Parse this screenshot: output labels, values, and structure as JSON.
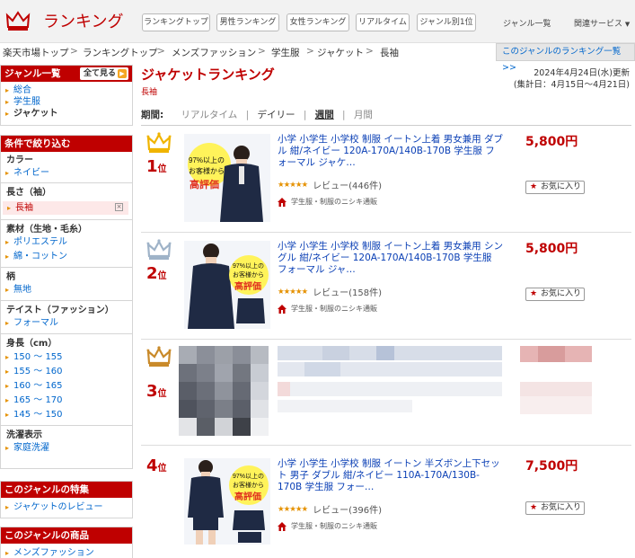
{
  "header": {
    "logo_text": "ランキング",
    "buttons": [
      "ランキングトップ",
      "男性ランキング",
      "女性ランキング",
      "リアルタイム",
      "ジャンル別1位"
    ],
    "links": [
      "ジャンル一覧",
      "関連サービス"
    ]
  },
  "breadcrumb": [
    "楽天市場トップ",
    "ランキングトップ",
    "メンズファッション",
    "学生服",
    "ジャケット",
    "長袖"
  ],
  "genre_ranking_link": "このジャンルのランキング一覧 >>",
  "sidebar": {
    "genre_title": "ジャンル一覧",
    "show_all": "全て見る",
    "genre_items": [
      "総合",
      "学生服",
      "ジャケット"
    ],
    "filter_title": "条件で絞り込む",
    "color_title": "カラー",
    "color_items": [
      "ネイビー"
    ],
    "sleeve_title": "長さ（袖）",
    "sleeve_items": [
      "長袖"
    ],
    "material_title": "素材（生地・毛糸）",
    "material_items": [
      "ポリエステル",
      "綿・コットン"
    ],
    "pattern_title": "柄",
    "pattern_items": [
      "無地"
    ],
    "taste_title": "テイスト（ファッション）",
    "taste_items": [
      "フォーマル"
    ],
    "height_title": "身長（cm）",
    "height_items": [
      "150 ～ 155",
      "155 ～ 160",
      "160 ～ 165",
      "165 ～ 170",
      "145 ～ 150"
    ],
    "wash_title": "洗濯表示",
    "wash_items": [
      "家庭洗濯"
    ],
    "feature_title": "このジャンルの特集",
    "feature_items": [
      "ジャケットのレビュー"
    ],
    "products_title": "このジャンルの商品",
    "products_items": [
      "メンズファッション"
    ]
  },
  "main": {
    "title": "ジャケットランキング",
    "subtag": "長袖",
    "updated": "2024年4月24日(水)更新",
    "period_range": "(集計日：4月15日～4月21日)",
    "period_label": "期間:",
    "periods": [
      "リアルタイム",
      "デイリー",
      "週間",
      "月間"
    ],
    "active_period": "週間"
  },
  "items": [
    {
      "rank": "1",
      "rank_suffix": "位",
      "title": "小学 小学生 小学校 制服 イートン上着 男女兼用 ダブル 紺/ネイビー 120A-170A/140B-170B 学生服 フォーマル ジャケ…",
      "stars": "★★★★★",
      "reviews": "レビュー(446件)",
      "shop": "学生服・制服のニシキ通販",
      "price": "5,800円",
      "fav": "お気に入り",
      "badge_line1": "97%以上の",
      "badge_line2": "お客様から",
      "badge_line3": "高評価"
    },
    {
      "rank": "2",
      "rank_suffix": "位",
      "title": "小学 小学生 小学校 制服 イートン上着 男女兼用 シングル 紺/ネイビー 120A-170A/140B-170B 学生服 フォーマル ジャ…",
      "stars": "★★★★★",
      "reviews": "レビュー(158件)",
      "shop": "学生服・制服のニシキ通販",
      "price": "5,800円",
      "fav": "お気に入り",
      "badge_line1": "97%以上の",
      "badge_line2": "お客様から",
      "badge_line3": "高評価"
    },
    {
      "rank": "3",
      "rank_suffix": "位"
    },
    {
      "rank": "4",
      "rank_suffix": "位",
      "title": "小学 小学生 小学校 制服 イートン 半ズボン上下セット 男子 ダブル 紺/ネイビー 110A-170A/130B-170B 学生服 フォー…",
      "stars": "★★★★★",
      "reviews": "レビュー(396件)",
      "shop": "学生服・制服のニシキ通販",
      "price": "7,500円",
      "fav": "お気に入り",
      "badge_line1": "97%以上の",
      "badge_line2": "お客様から",
      "badge_line3": "高評価"
    }
  ],
  "colors": {
    "brand": "#bf0000",
    "link": "#0a3fb5",
    "gold": "#f0b400",
    "silver": "#9fb3c8",
    "bronze": "#c98a2a"
  }
}
